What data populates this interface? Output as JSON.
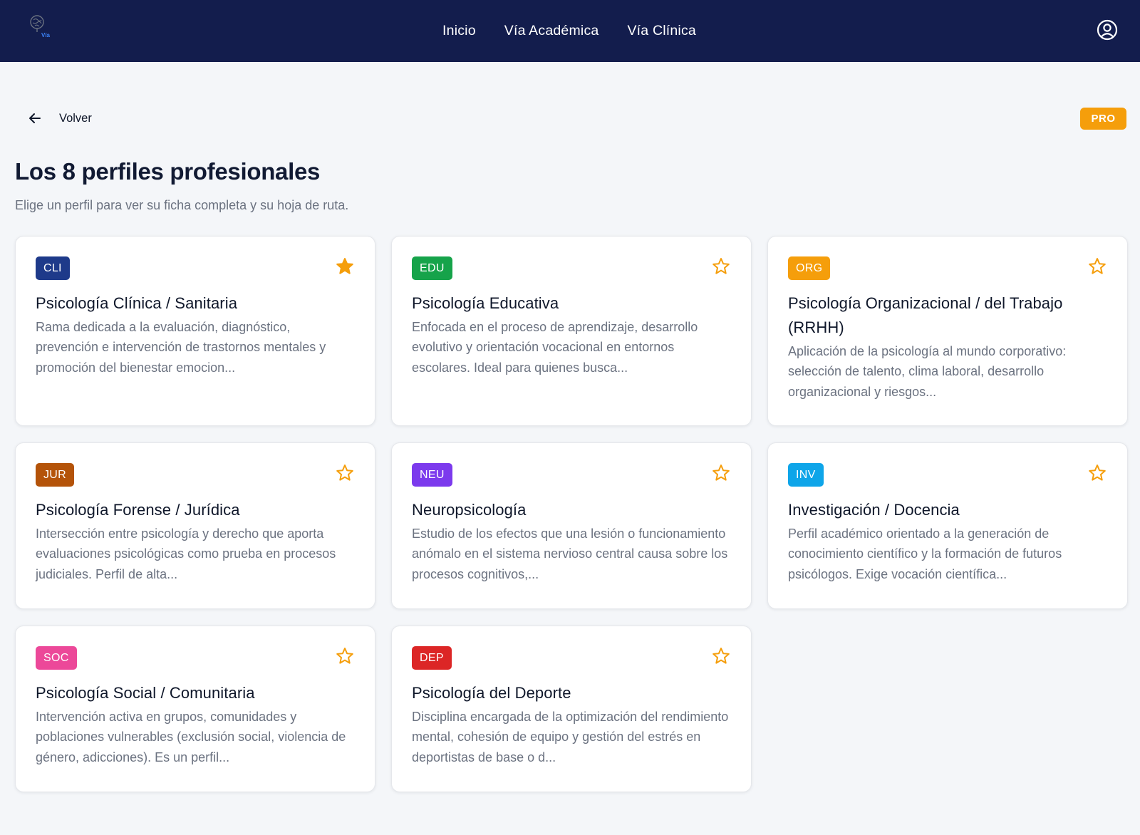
{
  "navbar": {
    "logo_text": "Vía",
    "links": [
      "Inicio",
      "Vía Académica",
      "Vía Clínica"
    ]
  },
  "back_label": "Volver",
  "pro_badge": "PRO",
  "page_title": "Los 8 perfiles profesionales",
  "page_subtitle": "Elige un perfil para ver su ficha completa y su hoja de ruta.",
  "colors": {
    "navbar_bg": "#131d4d",
    "star": "#f59e0b",
    "pro_badge": "#f59e0b"
  },
  "cards": [
    {
      "tag": "CLI",
      "tag_color": "#1e3a8a",
      "favorite": true,
      "title": "Psicología Clínica / Sanitaria",
      "description": "Rama dedicada a la evaluación, diagnóstico, prevención e intervención de trastornos mentales y promoción del bienestar emocion..."
    },
    {
      "tag": "EDU",
      "tag_color": "#16a34a",
      "favorite": false,
      "title": "Psicología Educativa",
      "description": "Enfocada en el proceso de aprendizaje, desarrollo evolutivo y orientación vocacional en entornos escolares. Ideal para quienes busca..."
    },
    {
      "tag": "ORG",
      "tag_color": "#f59e0b",
      "favorite": false,
      "title": "Psicología Organizacional / del Trabajo (RRHH)",
      "description": "Aplicación de la psicología al mundo corporativo: selección de talento, clima laboral, desarrollo organizacional y riesgos..."
    },
    {
      "tag": "JUR",
      "tag_color": "#b45309",
      "favorite": false,
      "title": "Psicología Forense / Jurídica",
      "description": "Intersección entre psicología y derecho que aporta evaluaciones psicológicas como prueba en procesos judiciales. Perfil de alta..."
    },
    {
      "tag": "NEU",
      "tag_color": "#7c3aed",
      "favorite": false,
      "title": "Neuropsicología",
      "description": "Estudio de los efectos que una lesión o funcionamiento anómalo en el sistema nervioso central causa sobre los procesos cognitivos,..."
    },
    {
      "tag": "INV",
      "tag_color": "#0ea5e9",
      "favorite": false,
      "title": "Investigación / Docencia",
      "description": "Perfil académico orientado a la generación de conocimiento científico y la formación de futuros psicólogos. Exige vocación científica..."
    },
    {
      "tag": "SOC",
      "tag_color": "#ec4899",
      "favorite": false,
      "title": "Psicología Social / Comunitaria",
      "description": "Intervención activa en grupos, comunidades y poblaciones vulnerables (exclusión social, violencia de género, adicciones). Es un perfil..."
    },
    {
      "tag": "DEP",
      "tag_color": "#dc2626",
      "favorite": false,
      "title": "Psicología del Deporte",
      "description": "Disciplina encargada de la optimización del rendimiento mental, cohesión de equipo y gestión del estrés en deportistas de base o d..."
    }
  ]
}
